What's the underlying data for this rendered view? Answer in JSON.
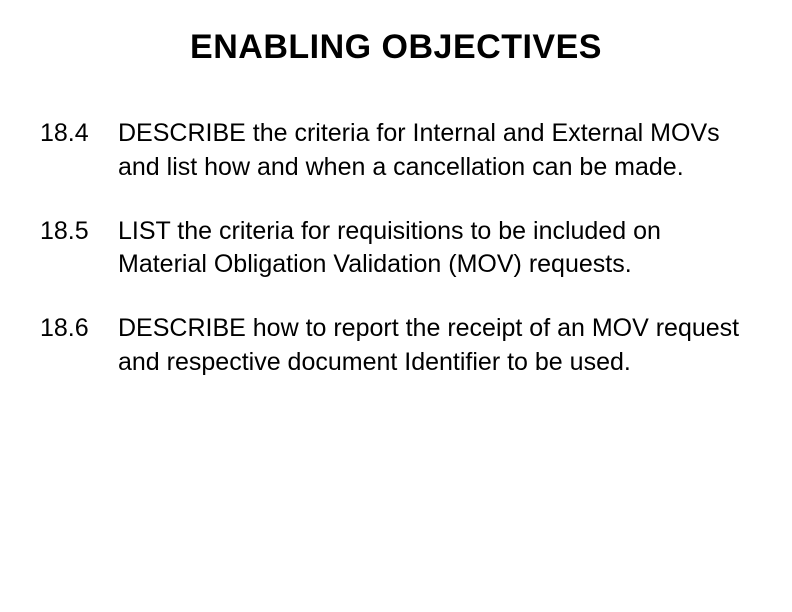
{
  "title": "ENABLING OBJECTIVES",
  "objectives": [
    {
      "num": "18.4",
      "verb": "DESCRIBE",
      "rest": " the criteria for Internal and External MOVs and list how and when a cancellation can be made."
    },
    {
      "num": "18.5",
      "verb": "LIST",
      "rest": " the criteria for requisitions to be included on Material Obligation Validation (MOV) requests."
    },
    {
      "num": "18.6",
      "verb": "DESCRIBE",
      "rest": " how to report the receipt of an MOV request and respective document Identifier to be used."
    }
  ]
}
